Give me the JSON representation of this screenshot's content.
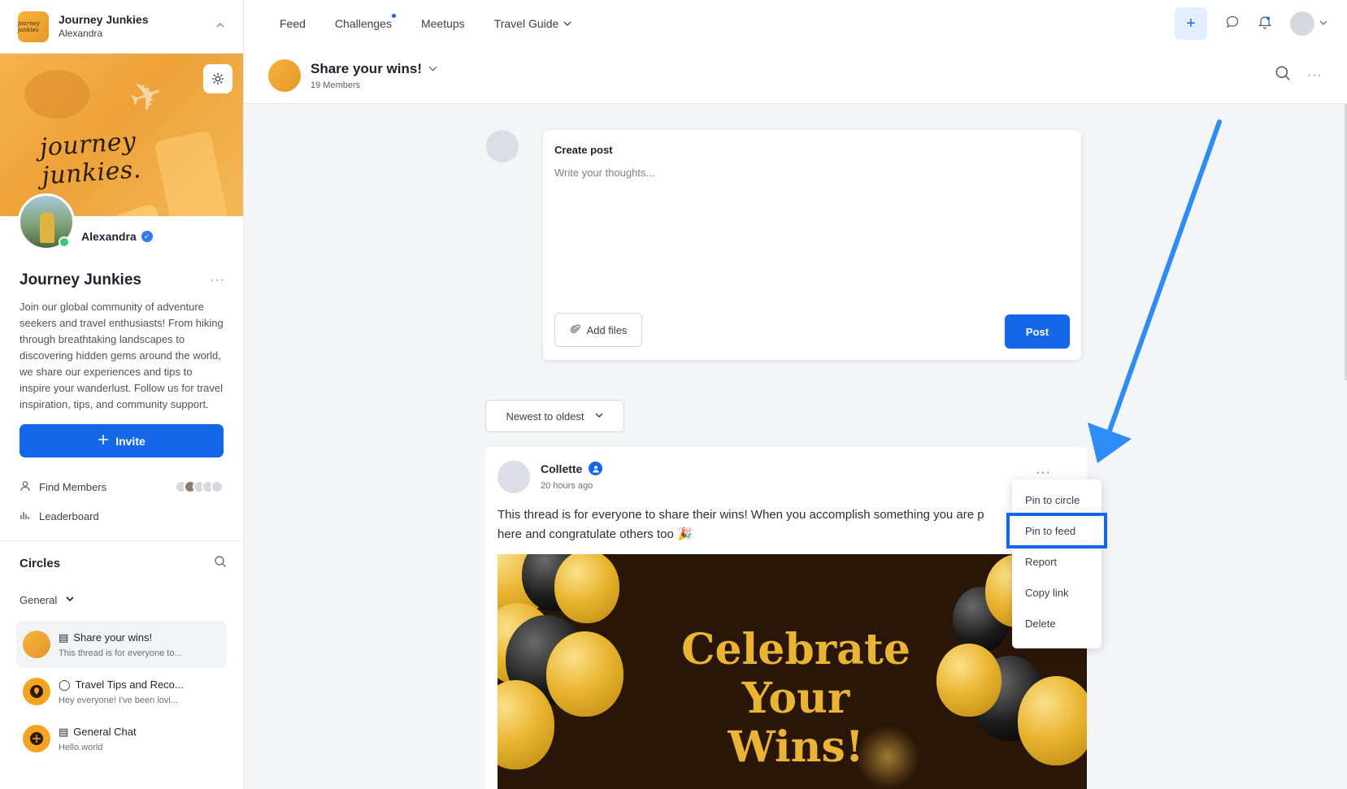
{
  "workspace": {
    "name": "Journey Junkies",
    "user": "Alexandra",
    "logo_text": "journey junkies"
  },
  "cover": {
    "script_text": "journey junkies."
  },
  "profile": {
    "name": "Alexandra"
  },
  "community": {
    "title": "Journey Junkies",
    "description": "Join our global community of adventure seekers and travel enthusiasts! From hiking through breathtaking landscapes to discovering hidden gems around the world, we share our experiences and tips to inspire your wanderlust. Follow us for travel inspiration, tips, and community support.",
    "invite_label": "Invite"
  },
  "sidebar_links": {
    "find_members": "Find Members",
    "leaderboard": "Leaderboard"
  },
  "circles": {
    "title": "Circles",
    "group": "General",
    "items": [
      {
        "title": "Share your wins!",
        "sub": "This thread is for everyone to..."
      },
      {
        "title": "Travel Tips and Reco...",
        "sub": "Hey everyone! I've been lovi..."
      },
      {
        "title": "General Chat",
        "sub": "Hello.world"
      }
    ]
  },
  "topnav": {
    "items": [
      "Feed",
      "Challenges",
      "Meetups",
      "Travel Guide"
    ],
    "plus": "+"
  },
  "circle_header": {
    "title": "Share your wins!",
    "members": "19 Members"
  },
  "composer": {
    "title": "Create post",
    "placeholder": "Write your thoughts...",
    "add_files": "Add files",
    "post": "Post"
  },
  "sort": {
    "selected": "Newest to oldest"
  },
  "post": {
    "author": "Collette",
    "time": "20 hours ago",
    "body": "This thread is for everyone to share their wins! When you accomplish something you are p",
    "body_line2": "here and congratulate others too 🎉",
    "image_text_line1": "Celebrate Your",
    "image_text_line2": "Wins!"
  },
  "menu": {
    "items": [
      "Pin to circle",
      "Pin to feed",
      "Report",
      "Copy link",
      "Delete"
    ],
    "highlighted": "Pin to feed"
  },
  "colors": {
    "accent": "#1467e6",
    "annotation": "#2e8cf6",
    "gold": "#e9b434"
  }
}
